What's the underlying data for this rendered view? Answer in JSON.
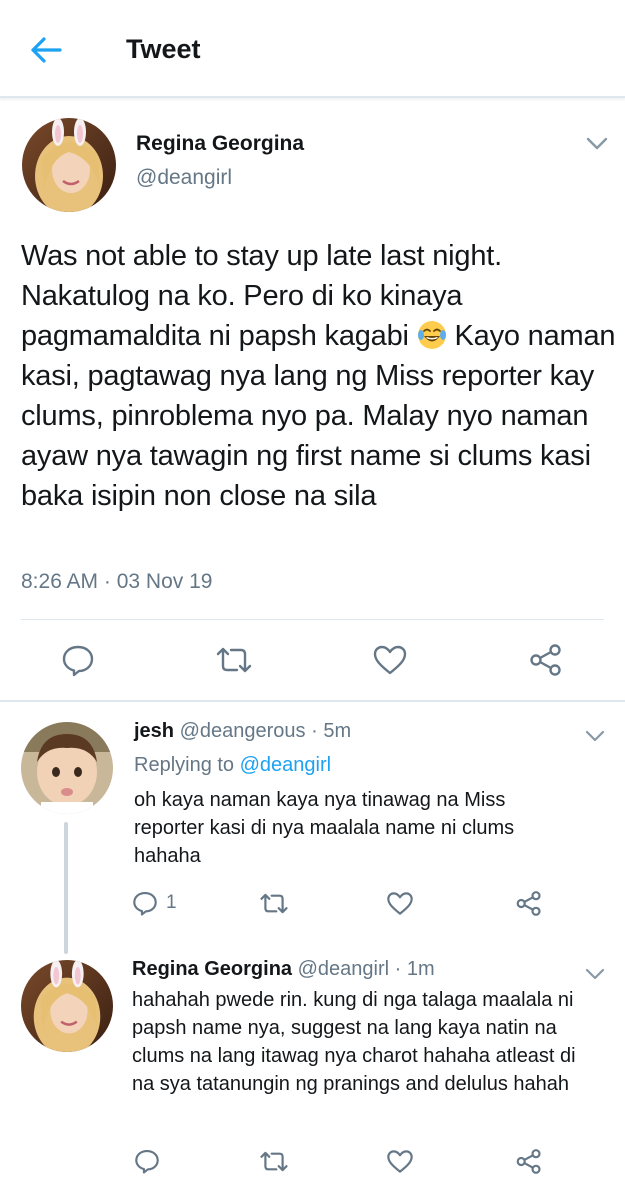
{
  "header": {
    "title": "Tweet",
    "back_icon": "arrow-left-icon",
    "accent": "#1da1f2"
  },
  "main_tweet": {
    "name": "Regina Georgina",
    "handle": "@deangirl",
    "text_before_emoji": "Was not able to stay up late last night. Nakatulog na ko. Pero di ko kinaya pagmamaldita ni papsh kagabi ",
    "emoji": "face-with-tears-of-joy",
    "text_after_emoji": " Kayo naman kasi, pagtawag nya lang ng Miss reporter kay clums, pinroblema nyo pa. Malay nyo naman ayaw nya tawagin ng first name si clums kasi baka isipin non close na sila",
    "timestamp": "8:26 AM · 03 Nov 19",
    "actions": [
      "reply-icon",
      "retweet-icon",
      "like-icon",
      "share-icon"
    ]
  },
  "replies": [
    {
      "name": "jesh",
      "handle_time": "@deangerous · 5m",
      "replying_label": "Replying to",
      "replying_to": "@deangirl",
      "text": "oh kaya naman kaya nya tinawag na Miss reporter kasi di nya maalala name ni clums hahaha",
      "reply_count": "1"
    },
    {
      "name": "Regina Georgina",
      "handle_time": "@deangirl · 1m",
      "text": "hahahah pwede rin. kung di nga talaga maalala ni papsh name nya, suggest na lang kaya natin na clums na lang itawag nya charot hahaha atleast di na sya tatanungin ng pranings and delulus hahah"
    }
  ],
  "colors": {
    "text_primary": "#14171a",
    "text_secondary": "#657786",
    "link": "#1da1f2",
    "divider": "#e1e8ed"
  }
}
